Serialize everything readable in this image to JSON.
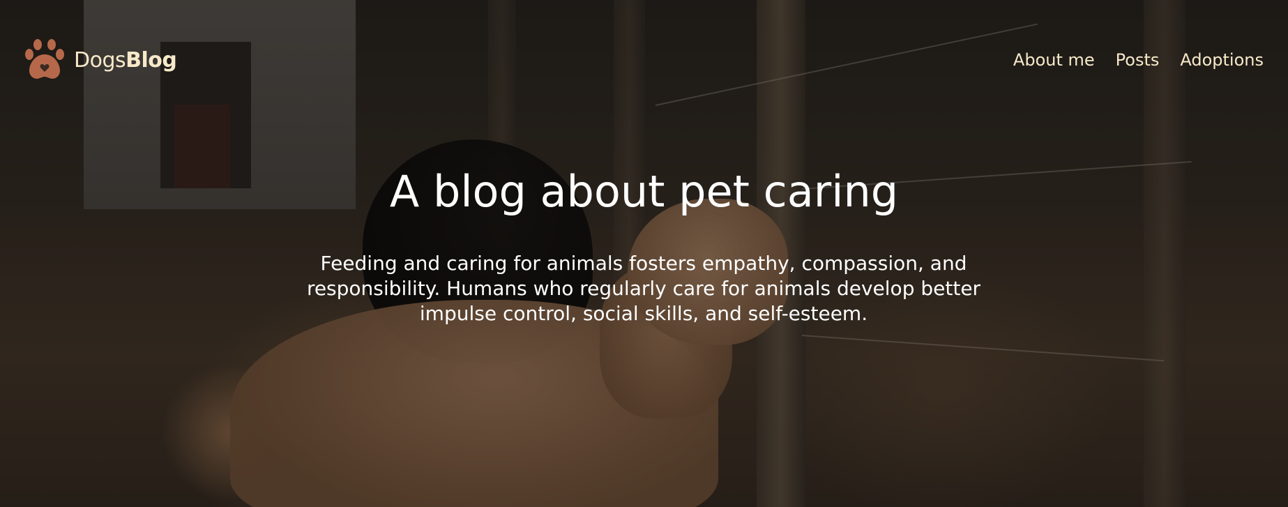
{
  "brand": {
    "name_regular": "Dogs",
    "name_bold": "Blog",
    "logo_icon": "paw-heart-icon",
    "logo_color": "#b6694a",
    "text_color": "#f7e9c9"
  },
  "nav": {
    "items": [
      {
        "label": "About me"
      },
      {
        "label": "Posts"
      },
      {
        "label": "Adoptions"
      }
    ]
  },
  "hero": {
    "title": "A blog about pet caring",
    "description": "Feeding and caring for animals fosters empathy, compassion, and responsibility. Humans who regularly care for animals develop better impulse control, social skills, and self-esteem.",
    "background_image": "dogs-by-fence-photo"
  }
}
